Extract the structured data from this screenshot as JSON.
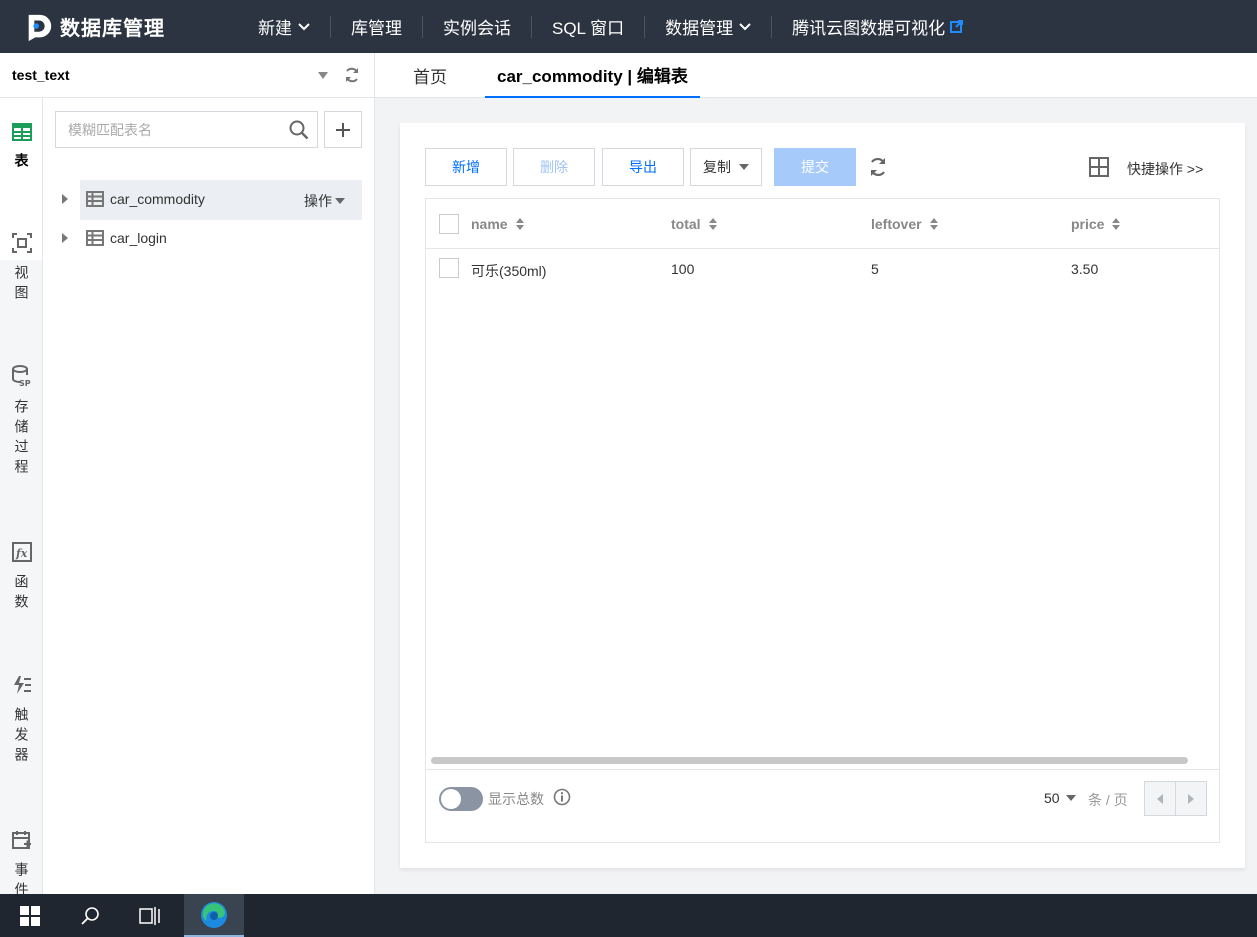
{
  "topbar": {
    "app_title": "数据库管理",
    "nav": [
      {
        "label": "新建",
        "dropdown": true
      },
      {
        "label": "库管理",
        "dropdown": false
      },
      {
        "label": "实例会话",
        "dropdown": false
      },
      {
        "label": "SQL 窗口",
        "dropdown": false
      },
      {
        "label": "数据管理",
        "dropdown": true
      },
      {
        "label": "腾讯云图数据可视化",
        "external": true
      }
    ]
  },
  "database": {
    "name": "test_text"
  },
  "rail": [
    {
      "label": "表",
      "icon": "table-icon",
      "active": true
    },
    {
      "label": "视图",
      "icon": "view-icon",
      "active": false
    },
    {
      "label": "存储过程",
      "icon": "stored-procedure-icon",
      "active": false
    },
    {
      "label": "函数",
      "icon": "function-icon",
      "active": false
    },
    {
      "label": "触发器",
      "icon": "trigger-icon",
      "active": false
    },
    {
      "label": "事件",
      "icon": "event-icon",
      "active": false
    }
  ],
  "tree": {
    "search_placeholder": "模糊匹配表名",
    "items": [
      {
        "name": "car_commodity",
        "selected": true,
        "op_label": "操作"
      },
      {
        "name": "car_login",
        "selected": false
      }
    ]
  },
  "tabs": [
    {
      "label": "首页",
      "active": false
    },
    {
      "label": "car_commodity | 编辑表",
      "active": true
    }
  ],
  "toolbar": {
    "add": "新增",
    "delete": "删除",
    "export": "导出",
    "copy": "复制",
    "submit": "提交",
    "quick_ops": "快捷操作 >>"
  },
  "table": {
    "columns": [
      "name",
      "total",
      "leftover",
      "price"
    ],
    "rows": [
      [
        "可乐(350ml)",
        "100",
        "5",
        "3.50"
      ]
    ]
  },
  "footer": {
    "show_total_label": "显示总数",
    "show_total_enabled": false,
    "page_size": "50",
    "per_page_label": "条 / 页"
  },
  "colors": {
    "accent": "#006eff",
    "topbar_bg": "#2b3440",
    "rail_active_icon": "#1a9e5a"
  }
}
